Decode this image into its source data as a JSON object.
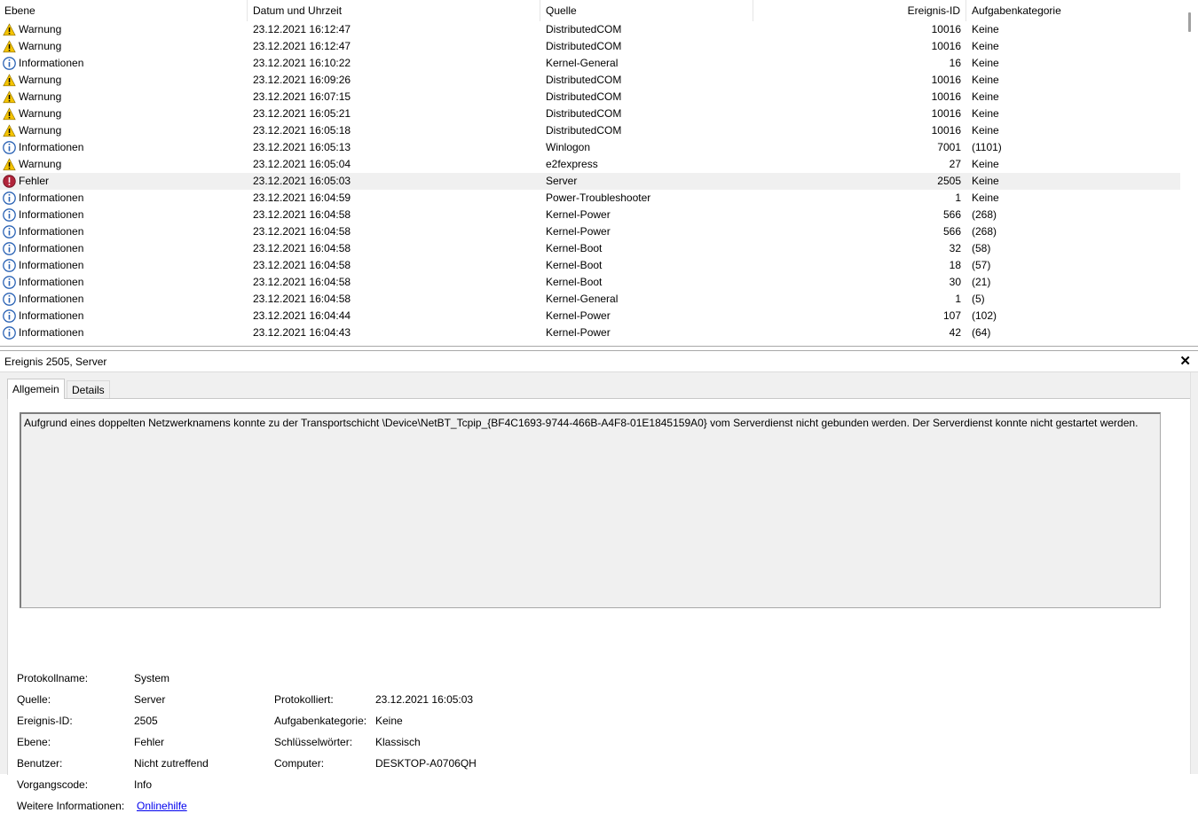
{
  "columns": {
    "ebene": "Ebene",
    "datum": "Datum und Uhrzeit",
    "quelle": "Quelle",
    "id": "Ereignis-ID",
    "kategorie": "Aufgabenkategorie"
  },
  "events": [
    {
      "level": "warning",
      "ebene": "Warnung",
      "datum": "23.12.2021 16:12:47",
      "quelle": "DistributedCOM",
      "id": "10016",
      "kategorie": "Keine"
    },
    {
      "level": "warning",
      "ebene": "Warnung",
      "datum": "23.12.2021 16:12:47",
      "quelle": "DistributedCOM",
      "id": "10016",
      "kategorie": "Keine"
    },
    {
      "level": "info",
      "ebene": "Informationen",
      "datum": "23.12.2021 16:10:22",
      "quelle": "Kernel-General",
      "id": "16",
      "kategorie": "Keine"
    },
    {
      "level": "warning",
      "ebene": "Warnung",
      "datum": "23.12.2021 16:09:26",
      "quelle": "DistributedCOM",
      "id": "10016",
      "kategorie": "Keine"
    },
    {
      "level": "warning",
      "ebene": "Warnung",
      "datum": "23.12.2021 16:07:15",
      "quelle": "DistributedCOM",
      "id": "10016",
      "kategorie": "Keine"
    },
    {
      "level": "warning",
      "ebene": "Warnung",
      "datum": "23.12.2021 16:05:21",
      "quelle": "DistributedCOM",
      "id": "10016",
      "kategorie": "Keine"
    },
    {
      "level": "warning",
      "ebene": "Warnung",
      "datum": "23.12.2021 16:05:18",
      "quelle": "DistributedCOM",
      "id": "10016",
      "kategorie": "Keine"
    },
    {
      "level": "info",
      "ebene": "Informationen",
      "datum": "23.12.2021 16:05:13",
      "quelle": "Winlogon",
      "id": "7001",
      "kategorie": "(1101)"
    },
    {
      "level": "warning",
      "ebene": "Warnung",
      "datum": "23.12.2021 16:05:04",
      "quelle": "e2fexpress",
      "id": "27",
      "kategorie": "Keine"
    },
    {
      "level": "error",
      "ebene": "Fehler",
      "datum": "23.12.2021 16:05:03",
      "quelle": "Server",
      "id": "2505",
      "kategorie": "Keine",
      "selected": true
    },
    {
      "level": "info",
      "ebene": "Informationen",
      "datum": "23.12.2021 16:04:59",
      "quelle": "Power-Troubleshooter",
      "id": "1",
      "kategorie": "Keine"
    },
    {
      "level": "info",
      "ebene": "Informationen",
      "datum": "23.12.2021 16:04:58",
      "quelle": "Kernel-Power",
      "id": "566",
      "kategorie": "(268)"
    },
    {
      "level": "info",
      "ebene": "Informationen",
      "datum": "23.12.2021 16:04:58",
      "quelle": "Kernel-Power",
      "id": "566",
      "kategorie": "(268)"
    },
    {
      "level": "info",
      "ebene": "Informationen",
      "datum": "23.12.2021 16:04:58",
      "quelle": "Kernel-Boot",
      "id": "32",
      "kategorie": "(58)"
    },
    {
      "level": "info",
      "ebene": "Informationen",
      "datum": "23.12.2021 16:04:58",
      "quelle": "Kernel-Boot",
      "id": "18",
      "kategorie": "(57)"
    },
    {
      "level": "info",
      "ebene": "Informationen",
      "datum": "23.12.2021 16:04:58",
      "quelle": "Kernel-Boot",
      "id": "30",
      "kategorie": "(21)"
    },
    {
      "level": "info",
      "ebene": "Informationen",
      "datum": "23.12.2021 16:04:58",
      "quelle": "Kernel-General",
      "id": "1",
      "kategorie": "(5)"
    },
    {
      "level": "info",
      "ebene": "Informationen",
      "datum": "23.12.2021 16:04:44",
      "quelle": "Kernel-Power",
      "id": "107",
      "kategorie": "(102)"
    },
    {
      "level": "info",
      "ebene": "Informationen",
      "datum": "23.12.2021 16:04:43",
      "quelle": "Kernel-Power",
      "id": "42",
      "kategorie": "(64)"
    }
  ],
  "detail": {
    "title": "Ereignis 2505, Server",
    "close": "✕",
    "tabs": {
      "allgemein": "Allgemein",
      "details": "Details"
    },
    "message": "Aufgrund eines doppelten Netzwerknamens konnte zu der Transportschicht \\Device\\NetBT_Tcpip_{BF4C1693-9744-466B-A4F8-01E1845159A0} vom Serverdienst nicht gebunden werden. Der Serverdienst konnte nicht gestartet werden.",
    "labels": {
      "protokollname": "Protokollname:",
      "quelle": "Quelle:",
      "ereignis_id": "Ereignis-ID:",
      "ebene": "Ebene:",
      "benutzer": "Benutzer:",
      "vorgangscode": "Vorgangscode:",
      "weitere": "Weitere Informationen:",
      "protokolliert": "Protokolliert:",
      "aufgabenkategorie": "Aufgabenkategorie:",
      "schluesselwoerter": "Schlüsselwörter:",
      "computer": "Computer:"
    },
    "values": {
      "protokollname": "System",
      "quelle": "Server",
      "ereignis_id": "2505",
      "ebene": "Fehler",
      "benutzer": "Nicht zutreffend",
      "vorgangscode": "Info",
      "weitere": "Onlinehilfe",
      "protokolliert": "23.12.2021 16:05:03",
      "aufgabenkategorie": "Keine",
      "schluesselwoerter": "Klassisch",
      "computer": "DESKTOP-A0706QH"
    }
  },
  "colors": {
    "warning": "#f5c400",
    "info": "#2b63b5",
    "error": "#b0243a",
    "link": "#0000ee"
  },
  "icons": {
    "warning": "warning-icon",
    "info": "information-icon",
    "error": "error-icon",
    "close": "close-icon"
  }
}
